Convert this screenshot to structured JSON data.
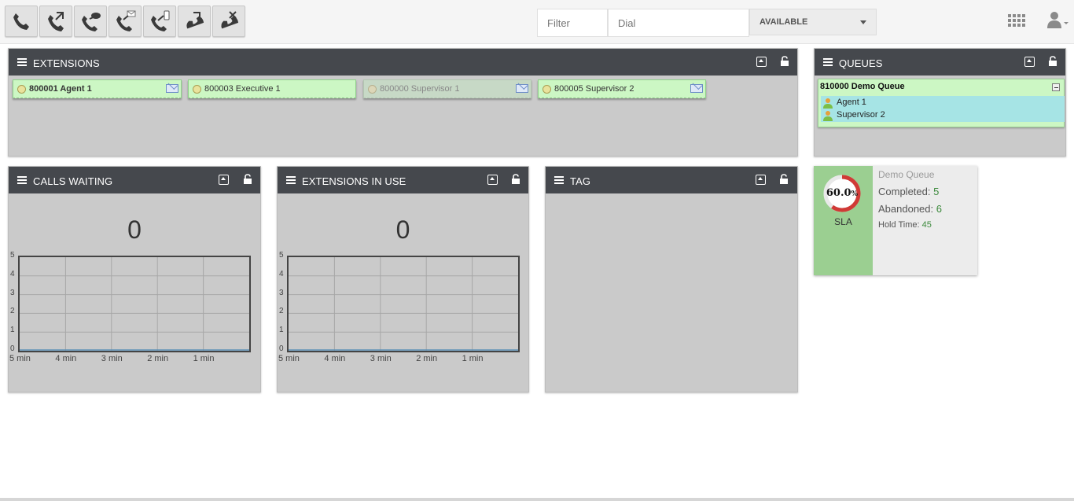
{
  "toolbar": {
    "buttons": [
      {
        "name": "call-button",
        "icon": "phone-icon"
      },
      {
        "name": "transfer-button",
        "icon": "phone-forward-icon"
      },
      {
        "name": "chat-call-button",
        "icon": "phone-chat-icon"
      },
      {
        "name": "voicemail-button",
        "icon": "phone-mail-icon"
      },
      {
        "name": "mobile-call-button",
        "icon": "phone-mobile-icon"
      },
      {
        "name": "pickup-button",
        "icon": "phone-pickup-icon"
      },
      {
        "name": "hangup-button",
        "icon": "phone-hangup-icon"
      }
    ],
    "filter_placeholder": "Filter",
    "dial_placeholder": "Dial",
    "status": "AVAILABLE"
  },
  "extensions_panel": {
    "title": "EXTENSIONS",
    "items": [
      {
        "label": "800001 Agent 1",
        "bold": true,
        "active": true
      },
      {
        "label": "800003 Executive 1",
        "bold": false,
        "active": true
      },
      {
        "label": "800000 Supervisor 1",
        "bold": false,
        "active": false
      },
      {
        "label": "800005 Supervisor 2",
        "bold": false,
        "active": true
      }
    ]
  },
  "queues_panel": {
    "title": "QUEUES",
    "queue_name": "810000 Demo Queue",
    "agents": [
      "Agent 1",
      "Supervisor 2"
    ]
  },
  "calls_waiting": {
    "title": "CALLS WAITING",
    "count": "0",
    "y_ticks": [
      "5",
      "4",
      "3",
      "2",
      "1",
      "0"
    ],
    "x_ticks": [
      "5 min",
      "4 min",
      "3 min",
      "2 min",
      "1 min"
    ]
  },
  "extensions_in_use": {
    "title": "EXTENSIONS IN USE",
    "count": "0",
    "y_ticks": [
      "5",
      "4",
      "3",
      "2",
      "1",
      "0"
    ],
    "x_ticks": [
      "5 min",
      "4 min",
      "3 min",
      "2 min",
      "1 min"
    ]
  },
  "tag_panel": {
    "title": "TAG"
  },
  "sla_card": {
    "sla_value": 60.0,
    "sla_number": "60.0",
    "sla_unit": "%",
    "sla_label": "SLA",
    "queue_name": "Demo Queue",
    "completed_label": "Completed:",
    "completed": "5",
    "abandoned_label": "Abandoned:",
    "abandoned": "6",
    "hold_label": "Hold Time:",
    "hold": "45"
  },
  "colors": {
    "panel_header": "#45484d",
    "panel_body": "#cacaca",
    "extension_green": "#ccf7c4",
    "agent_cyan": "#a6e4e5",
    "sla_green": "#9bcf91",
    "sla_ring": "#d03a36",
    "value_green": "#3c8a3c"
  }
}
